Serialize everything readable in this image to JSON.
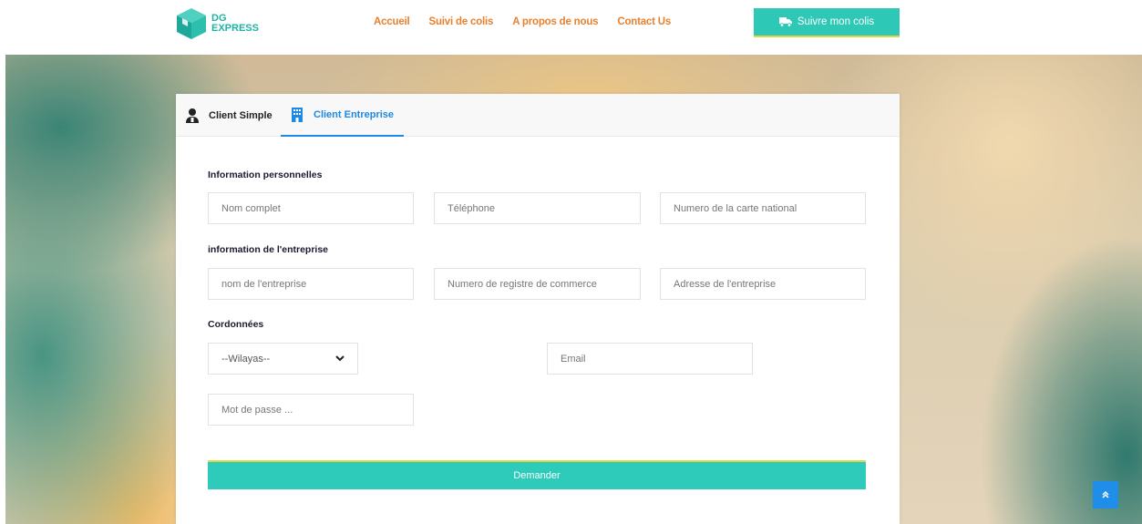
{
  "brand": {
    "logo_line1": "DG",
    "logo_line2": "EXPRESS"
  },
  "nav": {
    "items": [
      "Accueil",
      "Suivi de colis",
      "A propos de nous",
      "Contact Us"
    ],
    "track_button": "Suivre mon colis"
  },
  "tabs": [
    {
      "label": "Client Simple",
      "icon": "user-icon",
      "active": false
    },
    {
      "label": "Client Entreprise",
      "icon": "building-icon",
      "active": true
    }
  ],
  "form": {
    "personal_title": "Information personnelles",
    "full_name_placeholder": "Nom complet",
    "phone_placeholder": "Téléphone",
    "id_card_placeholder": "Numero de la carte national",
    "company_title": "information de l'entreprise",
    "company_name_placeholder": "nom de l'entreprise",
    "registry_placeholder": "Numero de registre de commerce",
    "company_address_placeholder": "Adresse de l'entreprise",
    "contact_title": "Cordonnées",
    "wilaya_selected": "--Wilayas--",
    "email_placeholder": "Email",
    "password_placeholder": "Mot de passe ...",
    "submit_label": "Demander"
  },
  "colors": {
    "accent_teal": "#2ecbbb",
    "nav_orange": "#e8812e",
    "tab_blue": "#1e88e5",
    "scroll_top_blue": "#1e8ee8"
  }
}
